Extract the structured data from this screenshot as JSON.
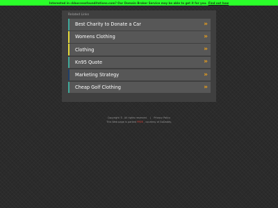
{
  "banner": {
    "text": "Interested in ckbuccessfounditations.com? Our Domain Broker Service may be able to get it for you.",
    "link_label": "Find out how",
    "color": "#2aff2a"
  },
  "panel": {
    "title": "Related Links",
    "links": [
      {
        "label": "Best Charity to Donate a Car",
        "accent": "#3fa89a",
        "icon": "double-chevron-right-icon"
      },
      {
        "label": "Womens Clothing",
        "accent": "#e3d93a",
        "icon": "double-chevron-right-icon"
      },
      {
        "label": "Clothing",
        "accent": "#e3d93a",
        "icon": "double-chevron-right-icon"
      },
      {
        "label": "Kn95 Quote",
        "accent": "#3fa89a",
        "icon": "double-chevron-right-icon"
      },
      {
        "label": "Marketing Strategy",
        "accent": "#1f3f6a",
        "icon": "double-chevron-right-icon"
      },
      {
        "label": "Cheap Golf Clothing",
        "accent": "#3fa89a",
        "icon": "double-chevron-right-icon"
      }
    ],
    "chevron_glyph": "»",
    "chevron_color": "#f0a21a"
  },
  "footer": {
    "copyright": "Copyright ©. All rights reserved.",
    "separator": "|",
    "privacy_label": "Privacy Policy",
    "line2_prefix": "This Web page is parked",
    "line2_link": "FREE",
    "line2_suffix": ", courtesy of GoDaddy."
  }
}
